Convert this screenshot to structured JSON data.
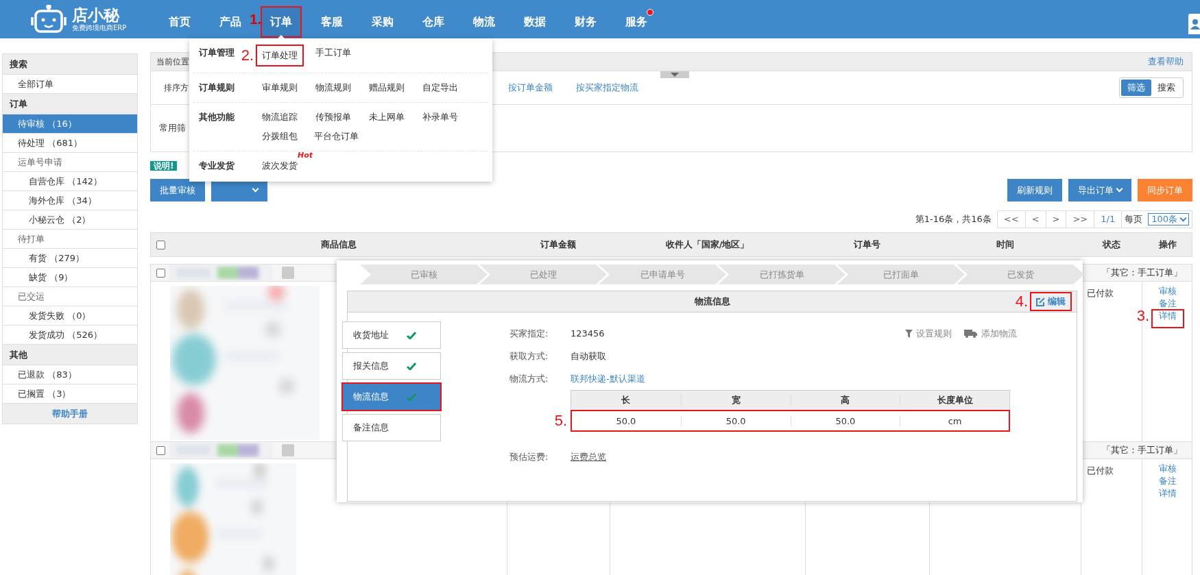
{
  "app": {
    "logo_name": "店小秘",
    "logo_tagline": "免费跨境电商ERP"
  },
  "nav": [
    {
      "label": "首页",
      "selected": false,
      "highlighted": false,
      "dot": false
    },
    {
      "label": "产品",
      "selected": false,
      "highlighted": false,
      "dot": false
    },
    {
      "label": "订单",
      "selected": true,
      "highlighted": true,
      "dot": false,
      "annotation": "1."
    },
    {
      "label": "客服",
      "selected": false,
      "highlighted": false,
      "dot": false
    },
    {
      "label": "采购",
      "selected": false,
      "highlighted": false,
      "dot": false
    },
    {
      "label": "仓库",
      "selected": false,
      "highlighted": false,
      "dot": false
    },
    {
      "label": "物流",
      "selected": false,
      "highlighted": false,
      "dot": false
    },
    {
      "label": "数据",
      "selected": false,
      "highlighted": false,
      "dot": false
    },
    {
      "label": "财务",
      "selected": false,
      "highlighted": false,
      "dot": false
    },
    {
      "label": "服务",
      "selected": false,
      "highlighted": false,
      "dot": true
    }
  ],
  "order_menu": [
    {
      "title": "订单管理",
      "items": [
        {
          "label": "订单处理",
          "highlighted": true,
          "annotation": "2."
        },
        {
          "label": "手工订单",
          "highlighted": false
        }
      ]
    },
    {
      "title": "订单规则",
      "items": [
        {
          "label": "审单规则",
          "highlighted": false
        },
        {
          "label": "物流规则",
          "highlighted": false
        },
        {
          "label": "赠品规则",
          "highlighted": false
        },
        {
          "label": "自定导出",
          "highlighted": false
        }
      ]
    },
    {
      "title": "其他功能",
      "items": [
        {
          "label": "物流追踪",
          "highlighted": false
        },
        {
          "label": "传预报单",
          "highlighted": false
        },
        {
          "label": "未上网单",
          "highlighted": false
        },
        {
          "label": "补录单号",
          "highlighted": false
        },
        {
          "label": "分拨组包",
          "highlighted": false
        },
        {
          "label": "平台仓订单",
          "highlighted": false
        }
      ]
    },
    {
      "title": "专业发货",
      "items": [
        {
          "label": "波次发货",
          "highlighted": false,
          "tag": "Hot"
        }
      ]
    }
  ],
  "sidebar": {
    "sections": [
      {
        "title": "搜索",
        "items": [
          {
            "label": "全部订单",
            "selected": false
          }
        ]
      },
      {
        "title": "订单",
        "items": [
          {
            "label": "待审核 （16）",
            "selected": true
          },
          {
            "label": "待处理 （681）",
            "selected": false
          },
          {
            "label": "运单号申请",
            "selected": false,
            "children": [
              {
                "label": "自营仓库 （142）",
                "selected": false
              },
              {
                "label": "海外仓库 （34）",
                "selected": false
              },
              {
                "label": "小秘云仓 （2）",
                "selected": false
              }
            ]
          },
          {
            "label": "待打单",
            "selected": false,
            "children": [
              {
                "label": "有货 （279）",
                "selected": false
              },
              {
                "label": "缺货 （9）",
                "selected": false
              }
            ]
          },
          {
            "label": "已交运",
            "selected": false,
            "children": [
              {
                "label": "发货失败 （0）",
                "selected": false
              },
              {
                "label": "发货成功 （526）",
                "selected": false
              }
            ]
          }
        ]
      },
      {
        "title": "其他",
        "items": [
          {
            "label": "已退款 （83）",
            "selected": false
          },
          {
            "label": "已搁置 （3）",
            "selected": false
          }
        ]
      }
    ],
    "help": "帮助手册"
  },
  "breadcrumb": {
    "label": "当前位置",
    "help": "查看帮助"
  },
  "sort": {
    "label": "排序方",
    "options": [
      "按订单金额",
      "按买家指定物流"
    ]
  },
  "view_toggle": [
    {
      "label": "筛选",
      "selected": true
    },
    {
      "label": "搜索",
      "selected": false
    }
  ],
  "filter": {
    "label": "常用筛"
  },
  "notice_tag": "说明!",
  "toolbar_left": [
    {
      "label": "批量审核"
    }
  ],
  "toolbar_right": [
    {
      "label": "刷新规则",
      "kind": "primary",
      "caret": false
    },
    {
      "label": "导出订单",
      "kind": "primary",
      "caret": true
    },
    {
      "label": "同步订单",
      "kind": "warning",
      "caret": false
    }
  ],
  "pagination": {
    "summary": "第1-16条，共16条",
    "buttons": [
      "<<",
      "<",
      ">",
      ">>"
    ],
    "page": "1/1",
    "per_page_label": "每页",
    "per_page": "100条"
  },
  "table": {
    "select_all_checked": false,
    "columns": [
      "商品信息",
      "订单金额",
      "收件人「国家/地区」",
      "订单号",
      "时间",
      "状态",
      "操作"
    ],
    "orders": [
      {
        "checked": false,
        "source": "「其它：手工订单」",
        "status": "已付款",
        "actions": [
          {
            "label": "审核",
            "highlighted": false
          },
          {
            "label": "备注",
            "highlighted": false
          },
          {
            "label": "详情",
            "highlighted": true,
            "annotation": "3."
          }
        ]
      },
      {
        "checked": false,
        "source": "「其它：手工订单」",
        "status": "已付款",
        "actions": [
          {
            "label": "审核",
            "highlighted": false
          },
          {
            "label": "备注",
            "highlighted": false
          },
          {
            "label": "详情",
            "highlighted": false
          }
        ]
      }
    ]
  },
  "detail_popup": {
    "steps": [
      "已审核",
      "已处理",
      "已申请单号",
      "已打拣货单",
      "已打面单",
      "已发货"
    ],
    "panel_title": "物流信息",
    "edit": {
      "label": "编辑",
      "highlighted": true,
      "annotation": "4."
    },
    "tabs": [
      {
        "label": "收货地址",
        "selected": false,
        "done": true,
        "highlighted": false
      },
      {
        "label": "报关信息",
        "selected": false,
        "done": true,
        "highlighted": false
      },
      {
        "label": "物流信息",
        "selected": true,
        "done": true,
        "highlighted": true
      },
      {
        "label": "备注信息",
        "selected": false,
        "done": false,
        "highlighted": false
      }
    ],
    "fields": [
      {
        "label": "买家指定:",
        "value": "123456",
        "kind": "text"
      },
      {
        "label": "获取方式:",
        "value": "自动获取",
        "kind": "text"
      },
      {
        "label": "物流方式:",
        "value": "联邦快递-默认渠道",
        "kind": "link"
      }
    ],
    "tools": [
      {
        "label": "设置规则",
        "kind": "filter"
      },
      {
        "label": "添加物流",
        "kind": "truck"
      }
    ],
    "dimensions": {
      "columns": [
        "长",
        "宽",
        "高",
        "长度单位"
      ],
      "values": [
        "50.0",
        "50.0",
        "50.0",
        "cm"
      ],
      "highlighted": true,
      "annotation": "5."
    },
    "estimate": {
      "label": "预估运费:",
      "value": "运费总览"
    }
  }
}
